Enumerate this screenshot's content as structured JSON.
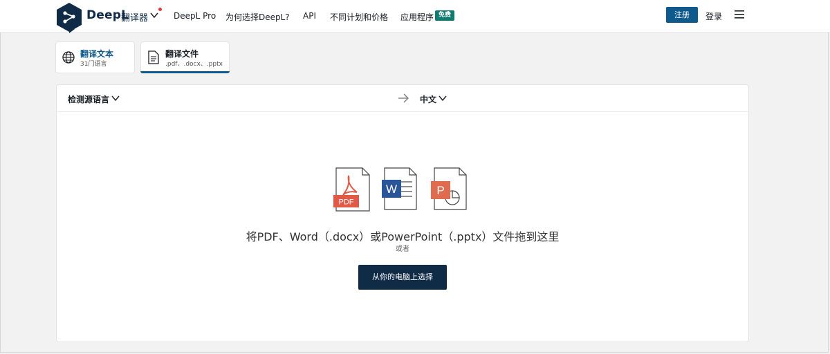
{
  "header": {
    "brand": "DeepL",
    "brand_sub": "翻译器",
    "nav": [
      "DeepL Pro",
      "为何选择DeepL?",
      "API",
      "不同计划和价格",
      "应用程序"
    ],
    "free_badge": "免费",
    "register": "注册",
    "login": "登录",
    "menu_icon": "hamburger-menu-icon"
  },
  "tabs": [
    {
      "title": "翻译文本",
      "subtitle": "31门语言",
      "icon": "globe-icon",
      "active": false
    },
    {
      "title": "翻译文件",
      "subtitle": ".pdf、.docx、.pptx",
      "icon": "document-icon",
      "active": true
    }
  ],
  "lang_bar": {
    "source": "检测源语言",
    "target": "中文"
  },
  "dropzone": {
    "file_types": [
      "PDF",
      "W",
      "P"
    ],
    "instruction": "将PDF、Word（.docx）或PowerPoint（.pptx）文件拖到这里",
    "or": "或者",
    "choose_button": "从你的电脑上选择"
  },
  "colors": {
    "brand_dark": "#0f2b46",
    "accent_blue": "#0f5a8c",
    "free_badge": "#0f7a6f",
    "pdf_red": "#e05a47",
    "word_blue": "#2a5699",
    "ppt_orange": "#e06c4f"
  }
}
